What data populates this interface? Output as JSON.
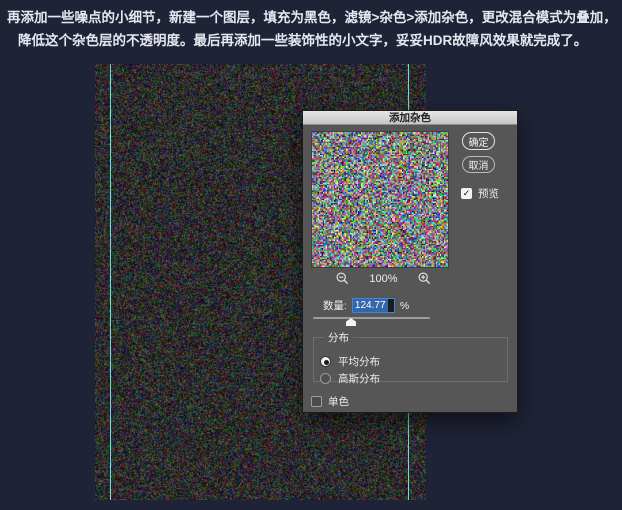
{
  "intro": {
    "line1": "再添加一些噪点的小细节，新建一个图层，填充为黑色，滤镜>杂色>添加杂色，更改混合模式为叠加，",
    "line2": "降低这个杂色层的不透明度。最后再添加一些装饰性的小文字，妥妥HDR故障风效果就完成了。"
  },
  "dialog": {
    "title": "添加杂色",
    "buttons": {
      "ok": "确定",
      "cancel": "取消"
    },
    "preview_checkbox": {
      "label": "预览",
      "checked": true
    },
    "zoom": {
      "level": "100%"
    },
    "amount": {
      "label": "数量:",
      "value": "124.77",
      "unit": "%"
    },
    "distribution": {
      "legend": "分布",
      "options": [
        {
          "label": "平均分布",
          "selected": true
        },
        {
          "label": "高斯分布",
          "selected": false
        }
      ]
    },
    "monochrome": {
      "label": "单色",
      "checked": false
    }
  },
  "icons": {
    "check": "✓"
  },
  "colors": {
    "page_bg": "#1f2337",
    "dialog_bg": "#565656",
    "titlebar_bg": "#d9d9d9",
    "guide_cyan": "#6fe8e6",
    "selection_blue": "#3566ab",
    "input_border_blue": "#4186d8"
  }
}
